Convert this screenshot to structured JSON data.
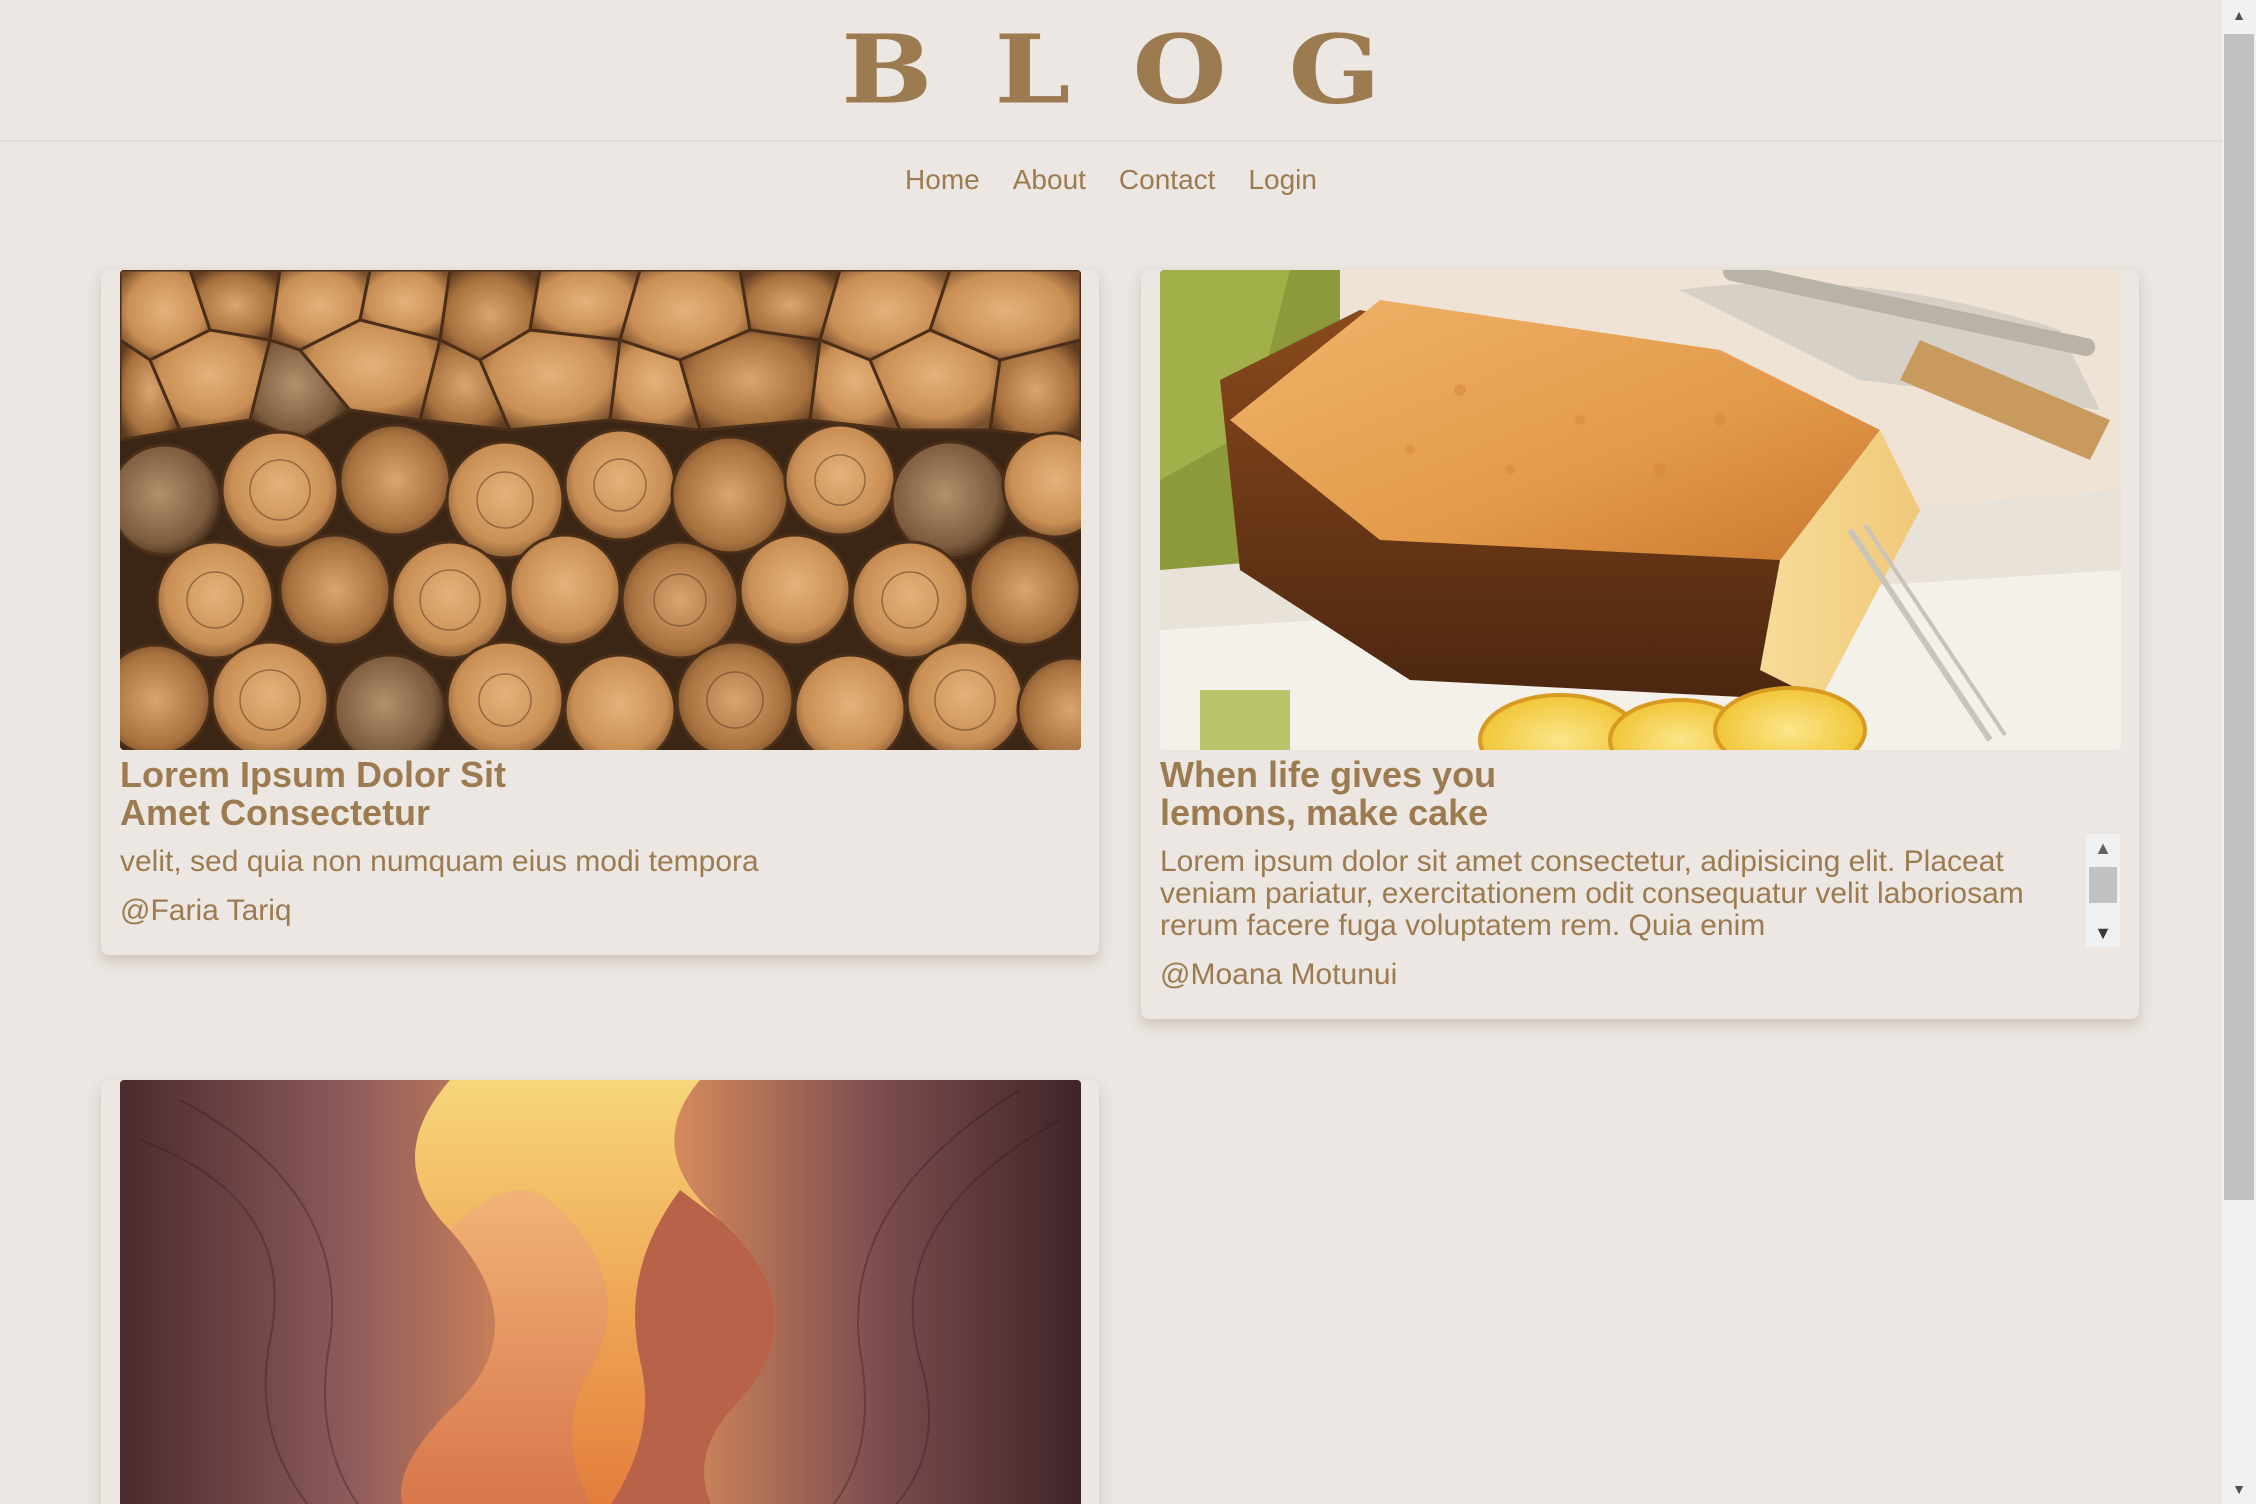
{
  "site": {
    "logo": "BLOG"
  },
  "nav": {
    "items": [
      {
        "label": "Home"
      },
      {
        "label": "About"
      },
      {
        "label": "Contact"
      },
      {
        "label": "Login"
      }
    ]
  },
  "posts": [
    {
      "title": "Lorem Ipsum Dolor Sit\nAmet Consectetur",
      "excerpt": "velit, sed quia non numquam eius modi tempora",
      "author": "@Faria Tariq",
      "image": "stacked firewood logs"
    },
    {
      "title": "When life gives you\nlemons, make cake",
      "excerpt": "Lorem ipsum dolor sit amet consectetur, adipisicing elit. Placeat veniam pariatur, exercitationem odit consequatur velit laboriosam rerum facere fuga voluptatem rem. Quia enim",
      "author": "@Moana Motunui",
      "image": "lemon pound cake with fork"
    },
    {
      "image": "sandstone slot canyon"
    }
  ],
  "colors": {
    "background": "#ece7e2",
    "accent": "#9c7b50"
  },
  "icons": {
    "scroll_up": "▲",
    "scroll_down": "▼"
  }
}
